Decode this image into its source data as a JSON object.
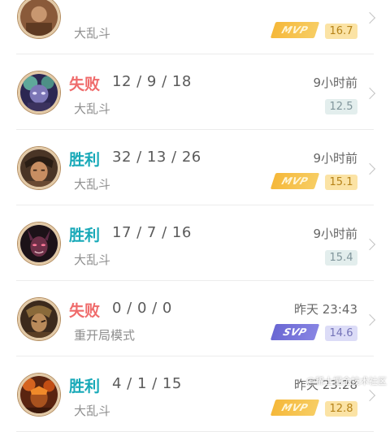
{
  "matches": [
    {
      "result": "",
      "kda": "",
      "mode": "大乱斗",
      "time": "",
      "badge": "MVP",
      "score": "16.7"
    },
    {
      "result": "失败",
      "kda": "12 / 9 / 18",
      "mode": "大乱斗",
      "time": "9小时前",
      "badge": "",
      "score": "12.5"
    },
    {
      "result": "胜利",
      "kda": "32 / 13 / 26",
      "mode": "大乱斗",
      "time": "9小时前",
      "badge": "MVP",
      "score": "15.1"
    },
    {
      "result": "胜利",
      "kda": "17 / 7 / 16",
      "mode": "大乱斗",
      "time": "9小时前",
      "badge": "",
      "score": "15.4"
    },
    {
      "result": "失败",
      "kda": "0 / 0 / 0",
      "mode": "重开局模式",
      "time": "昨天 23:43",
      "badge": "SVP",
      "score": "14.6"
    },
    {
      "result": "胜利",
      "kda": "4 / 1 / 15",
      "mode": "大乱斗",
      "time": "昨天 23:28",
      "badge": "MVP",
      "score": "12.8"
    }
  ],
  "colors": {
    "win": "#18a9b8",
    "lose": "#ef6b6b",
    "mvp": "#f5b83a",
    "svp": "#6a67d3"
  },
  "watermark": "@稀土掘金技术社区"
}
